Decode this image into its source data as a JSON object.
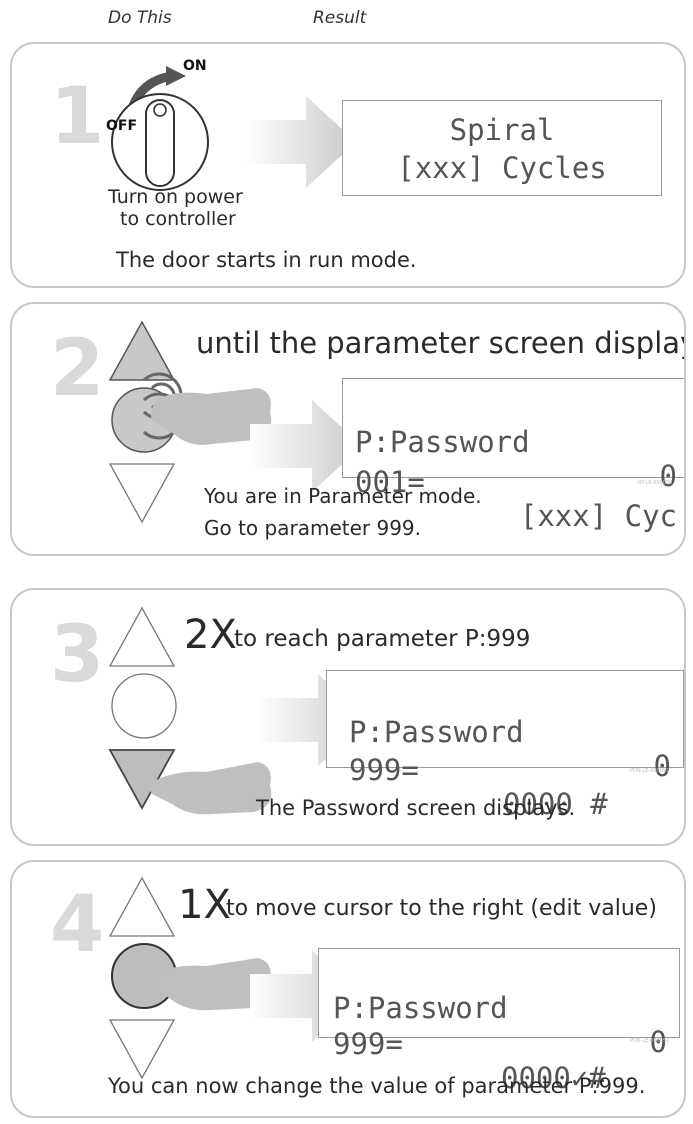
{
  "header": {
    "do_this": "Do This",
    "result": "Result"
  },
  "step1": {
    "number": "1",
    "switch_on": "ON",
    "switch_off": "OFF",
    "action_line1": "Turn on power",
    "action_line2": "to controller",
    "lcd_line1": "Spiral",
    "lcd_line2": "[xxx] Cycles",
    "note": "The door starts in run mode."
  },
  "step2": {
    "number": "2",
    "instruction": "until the parameter screen displays",
    "lcd_line1_left": "P:Password",
    "lcd_line1_right": "0",
    "lcd_line2_left": "001=",
    "lcd_line2_right": "[xxx] Cyc",
    "image_id": "RY-LE-000050",
    "note_line1": "You are in Parameter mode.",
    "note_line2": "Go to parameter 999."
  },
  "step3": {
    "number": "3",
    "count": "2X",
    "instruction": "to reach parameter P:999",
    "lcd_line1_left": "P:Password",
    "lcd_line1_right": "0",
    "lcd_line2_left": "999=",
    "lcd_line2_right": "0000 #",
    "image_id": "PDN-LE-000051",
    "note": "The Password screen displays."
  },
  "step4": {
    "number": "4",
    "count": "1X",
    "instruction": "to move cursor to the right (edit value)",
    "lcd_line1_left": "P:Password",
    "lcd_line1_right": "0",
    "lcd_line2_left": "999=",
    "lcd_line2_right": "0000✓#",
    "image_id": "PDN-LE-000052",
    "note": "You can now change the value of parameter P:999."
  }
}
